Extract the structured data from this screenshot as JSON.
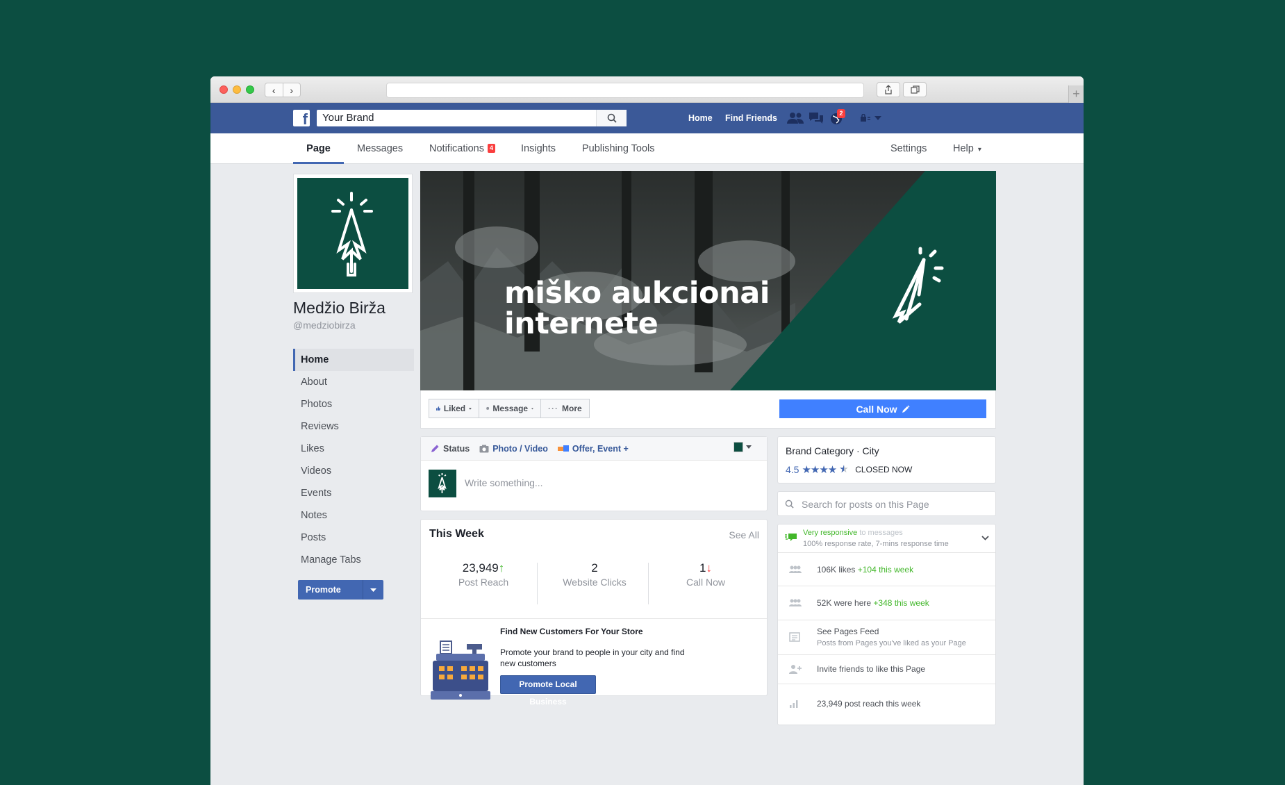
{
  "topbar": {
    "logo": "f",
    "search_value": "Your Brand",
    "home": "Home",
    "find_friends": "Find Friends",
    "notifications_count": "2"
  },
  "subnav": {
    "tabs": [
      {
        "label": "Page"
      },
      {
        "label": "Messages"
      },
      {
        "label": "Notifications"
      },
      {
        "label": "Insights"
      },
      {
        "label": "Publishing Tools"
      }
    ],
    "notifications_badge": "4",
    "settings": "Settings",
    "help": "Help",
    "help_caret": "▾"
  },
  "page": {
    "name": "Medžio Birža",
    "handle": "@medziobirza"
  },
  "left_nav": {
    "items": [
      {
        "label": "Home"
      },
      {
        "label": "About"
      },
      {
        "label": "Photos"
      },
      {
        "label": "Reviews"
      },
      {
        "label": "Likes"
      },
      {
        "label": "Videos"
      },
      {
        "label": "Events"
      },
      {
        "label": "Notes"
      },
      {
        "label": "Posts"
      },
      {
        "label": "Manage Tabs"
      }
    ],
    "promote": "Promote"
  },
  "cover": {
    "line1": "miško aukcionai",
    "line2": "internete"
  },
  "actions": {
    "liked": "Liked",
    "message": "Message",
    "more": "More",
    "call_now": "Call Now"
  },
  "composer": {
    "status": "Status",
    "photo_video": "Photo / Video",
    "offer_event": "Offer, Event +",
    "placeholder": "Write something..."
  },
  "this_week": {
    "title": "This Week",
    "see_all": "See All",
    "stats": [
      {
        "value": "23,949",
        "label": "Post Reach",
        "trend": "up"
      },
      {
        "value": "2",
        "label": "Website Clicks",
        "trend": "none"
      },
      {
        "value": "1",
        "label": "Call Now",
        "trend": "down"
      }
    ]
  },
  "promo": {
    "title": "Find New Customers For Your Store",
    "text_line1": "Promote your brand to people in your city and find",
    "text_line2": "new customers",
    "button": "Promote Local Business"
  },
  "right": {
    "category": "Brand Category",
    "dot": "·",
    "city": "City",
    "rating": "4.5",
    "stars": "★★★★",
    "closed": "CLOSED NOW",
    "search_placeholder": "Search for posts on this Page",
    "responsive": "Very responsive",
    "responsive_suffix": "to messages",
    "response_rate": "100% response rate, 7-mins response time",
    "likes": "106K likes",
    "likes_delta": "+104 this week",
    "here": "52K were here",
    "here_delta": "+348 this week",
    "feed_title": "See Pages Feed",
    "feed_sub": "Posts from Pages you've liked as your Page",
    "invite": "Invite friends to like this Page",
    "reach": "23,949 post reach this week"
  },
  "colors": {
    "brand_green": "#0c4e41",
    "fb_blue": "#3b5998",
    "call_blue": "#4080ff",
    "positive": "#42b72a",
    "negative": "#fa3e3e"
  }
}
